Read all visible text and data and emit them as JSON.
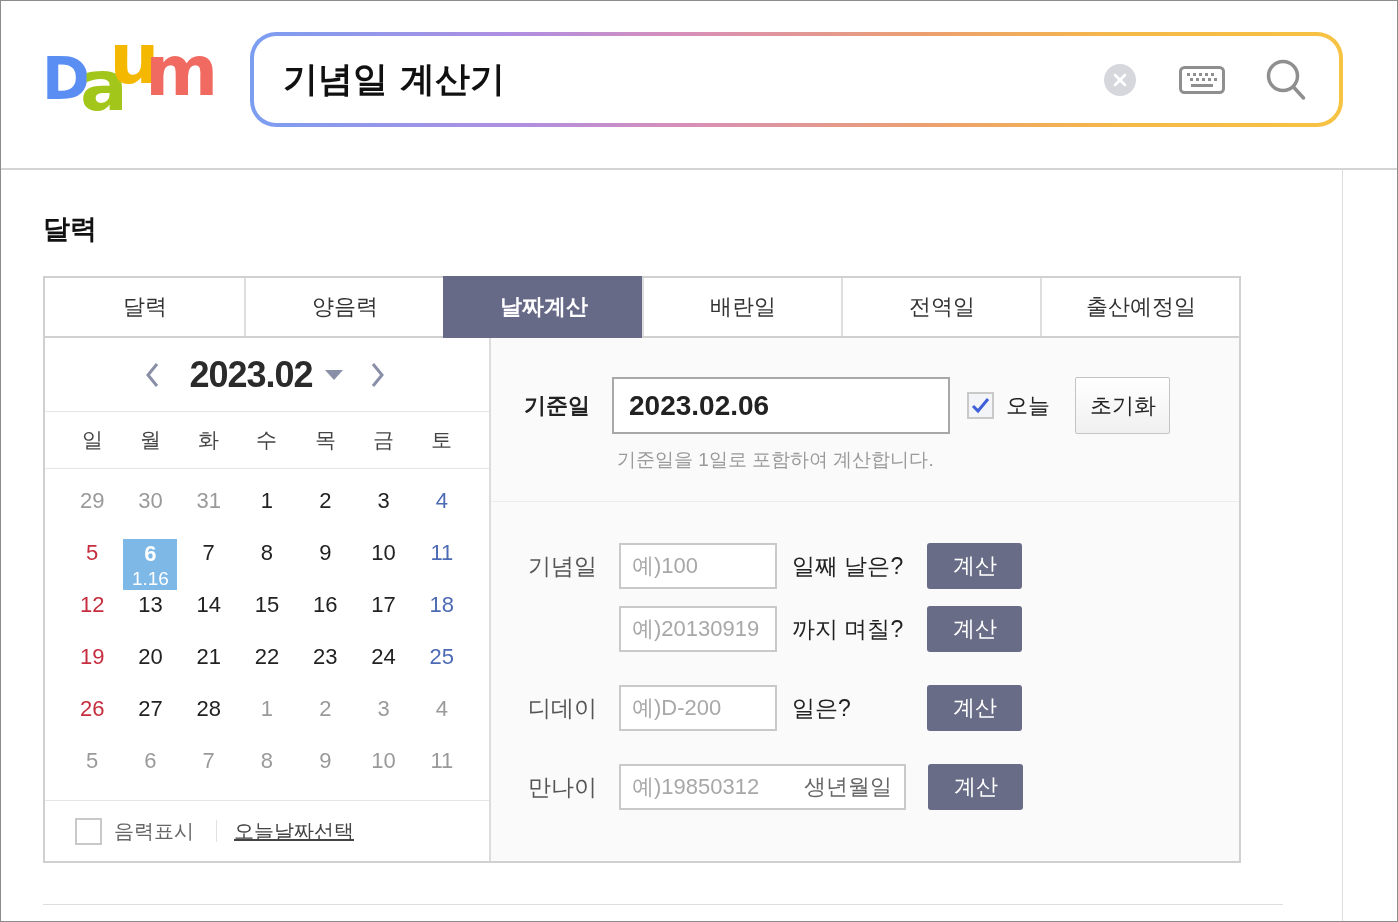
{
  "logo": {
    "letters": [
      {
        "char": "D",
        "color": "#5b8ef2"
      },
      {
        "char": "a",
        "color": "#a3c61a"
      },
      {
        "char": "u",
        "color": "#f5b800"
      },
      {
        "char": "m",
        "color": "#f06a62"
      }
    ]
  },
  "search": {
    "value": "기념일 계산기"
  },
  "section_title": "달력",
  "tabs": [
    {
      "label": "달력",
      "selected": false
    },
    {
      "label": "양음력",
      "selected": false
    },
    {
      "label": "날짜계산",
      "selected": true
    },
    {
      "label": "배란일",
      "selected": false
    },
    {
      "label": "전역일",
      "selected": false
    },
    {
      "label": "출산예정일",
      "selected": false
    }
  ],
  "calendar": {
    "month": "2023.02",
    "weekdays": [
      "일",
      "월",
      "화",
      "수",
      "목",
      "금",
      "토"
    ],
    "weeks": [
      [
        {
          "day": "29",
          "other_month": true,
          "selected": false
        },
        {
          "day": "30",
          "other_month": true,
          "selected": false
        },
        {
          "day": "31",
          "other_month": true,
          "selected": false
        },
        {
          "day": "1",
          "other_month": false,
          "selected": false
        },
        {
          "day": "2",
          "other_month": false,
          "selected": false
        },
        {
          "day": "3",
          "other_month": false,
          "selected": false
        },
        {
          "day": "4",
          "other_month": false,
          "selected": false
        }
      ],
      [
        {
          "day": "5",
          "other_month": false,
          "selected": false
        },
        {
          "day": "6",
          "other_month": false,
          "selected": true,
          "lunar": "1.16"
        },
        {
          "day": "7",
          "other_month": false,
          "selected": false
        },
        {
          "day": "8",
          "other_month": false,
          "selected": false
        },
        {
          "day": "9",
          "other_month": false,
          "selected": false
        },
        {
          "day": "10",
          "other_month": false,
          "selected": false
        },
        {
          "day": "11",
          "other_month": false,
          "selected": false
        }
      ],
      [
        {
          "day": "12",
          "other_month": false,
          "selected": false
        },
        {
          "day": "13",
          "other_month": false,
          "selected": false
        },
        {
          "day": "14",
          "other_month": false,
          "selected": false
        },
        {
          "day": "15",
          "other_month": false,
          "selected": false
        },
        {
          "day": "16",
          "other_month": false,
          "selected": false
        },
        {
          "day": "17",
          "other_month": false,
          "selected": false
        },
        {
          "day": "18",
          "other_month": false,
          "selected": false
        }
      ],
      [
        {
          "day": "19",
          "other_month": false,
          "selected": false
        },
        {
          "day": "20",
          "other_month": false,
          "selected": false
        },
        {
          "day": "21",
          "other_month": false,
          "selected": false
        },
        {
          "day": "22",
          "other_month": false,
          "selected": false
        },
        {
          "day": "23",
          "other_month": false,
          "selected": false
        },
        {
          "day": "24",
          "other_month": false,
          "selected": false
        },
        {
          "day": "25",
          "other_month": false,
          "selected": false
        }
      ],
      [
        {
          "day": "26",
          "other_month": false,
          "selected": false
        },
        {
          "day": "27",
          "other_month": false,
          "selected": false
        },
        {
          "day": "28",
          "other_month": false,
          "selected": false
        },
        {
          "day": "1",
          "other_month": true,
          "selected": false
        },
        {
          "day": "2",
          "other_month": true,
          "selected": false
        },
        {
          "day": "3",
          "other_month": true,
          "selected": false
        },
        {
          "day": "4",
          "other_month": true,
          "selected": false
        }
      ],
      [
        {
          "day": "5",
          "other_month": true,
          "selected": false
        },
        {
          "day": "6",
          "other_month": true,
          "selected": false
        },
        {
          "day": "7",
          "other_month": true,
          "selected": false
        },
        {
          "day": "8",
          "other_month": true,
          "selected": false
        },
        {
          "day": "9",
          "other_month": true,
          "selected": false
        },
        {
          "day": "10",
          "other_month": true,
          "selected": false
        },
        {
          "day": "11",
          "other_month": true,
          "selected": false
        }
      ]
    ],
    "lunar_toggle": {
      "label": "음력표시",
      "checked": false
    },
    "today_link": "오늘날짜선택"
  },
  "base_date": {
    "label": "기준일",
    "value": "2023.02.06",
    "today": {
      "label": "오늘",
      "checked": true
    },
    "reset_button": "초기화",
    "note": "기준일을 1일로 포함하여 계산합니다."
  },
  "groups": [
    {
      "label": "기념일",
      "rows": [
        {
          "kind": "question",
          "placeholder": "예)100",
          "question": "일째 날은?",
          "button": "계산"
        },
        {
          "kind": "question",
          "placeholder": "예)20130919",
          "question": "까지 며칠?",
          "button": "계산"
        }
      ]
    },
    {
      "label": "디데이",
      "rows": [
        {
          "kind": "question",
          "placeholder": "예)D-200",
          "question": "일은?",
          "button": "계산"
        }
      ]
    },
    {
      "label": "만나이",
      "rows": [
        {
          "kind": "birthdate",
          "placeholder": "예)19850312",
          "hint": "생년월일",
          "button": "계산"
        }
      ]
    }
  ]
}
